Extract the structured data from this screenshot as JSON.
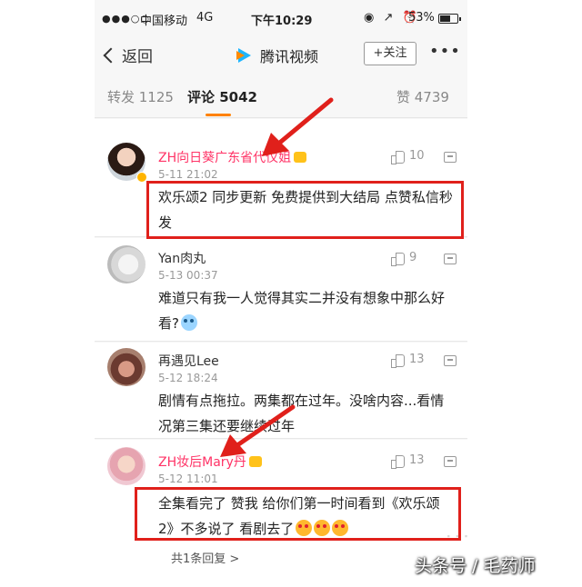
{
  "status_bar": {
    "signal": "●●●○○",
    "carrier": "中国移动",
    "network": "4G",
    "time": "下午10:29",
    "icons": "◉ ↗ ⏰",
    "battery": "53%"
  },
  "nav": {
    "back_label": "返回",
    "title": "腾讯视频",
    "follow_label": "+关注",
    "more_label": "•••"
  },
  "tabs": {
    "repost": "转发 1125",
    "comments": "评论 5042",
    "likes": "赞 4739"
  },
  "comments": [
    {
      "name": "ZH向日葵广东省代仪姐",
      "date": "5-11 21:02",
      "likes": "10",
      "text": "欢乐颂2 同步更新 免费提供到大结局 点赞私信秒发"
    },
    {
      "name": "Yan肉丸",
      "date": "5-13 00:37",
      "likes": "9",
      "text": "难道只有我一人觉得其实二并没有想象中那么好看?"
    },
    {
      "name": "再遇见Lee",
      "date": "5-12 18:24",
      "likes": "13",
      "text": "剧情有点拖拉。两集都在过年。没啥内容...看情况第三集还要继续过年"
    },
    {
      "name": "ZH妆后Mary丹",
      "date": "5-12 11:01",
      "likes": "13",
      "text": "全集看完了 赞我 给你们第一时间看到《欢乐颂2》不多说了 看剧去了"
    }
  ],
  "reply_count": "共1条回复 >",
  "watermark": "头条号 / 毛药师",
  "colors": {
    "accent": "#ff8200",
    "highlight": "#e0201b",
    "vip_name": "#ff3366"
  }
}
